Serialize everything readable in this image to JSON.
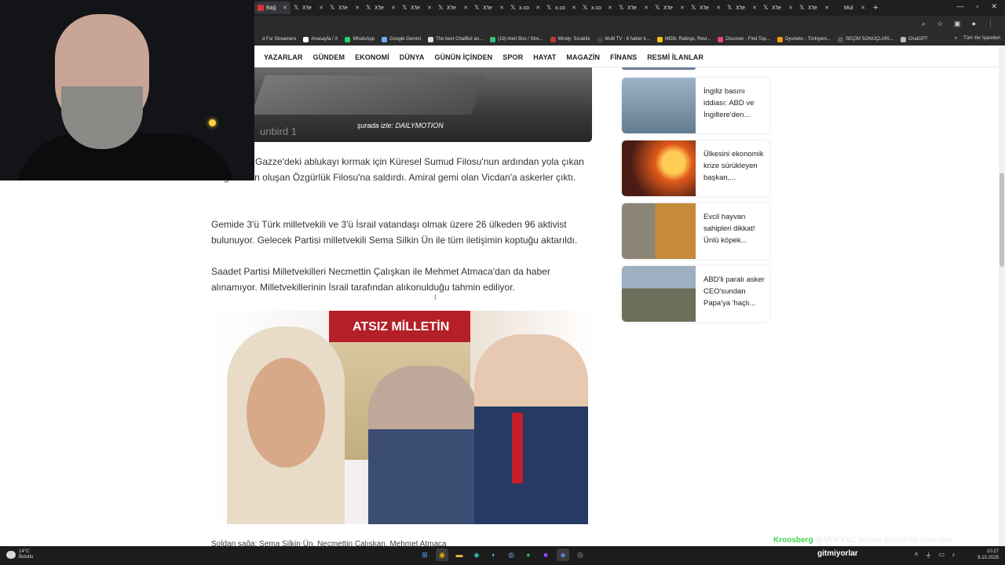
{
  "tabs": [
    {
      "label": "Bağ",
      "favicon": "red",
      "active": true
    },
    {
      "label": "X'te",
      "favicon": "x"
    },
    {
      "label": "X'te",
      "favicon": "x"
    },
    {
      "label": "X'te",
      "favicon": "x"
    },
    {
      "label": "X'te",
      "favicon": "x"
    },
    {
      "label": "X'te",
      "favicon": "x"
    },
    {
      "label": "X'te",
      "favicon": "x"
    },
    {
      "label": "x.co",
      "favicon": "x"
    },
    {
      "label": "x.co",
      "favicon": "x"
    },
    {
      "label": "x.co",
      "favicon": "x"
    },
    {
      "label": "X'te",
      "favicon": "x"
    },
    {
      "label": "X'te",
      "favicon": "x"
    },
    {
      "label": "X'te",
      "favicon": "x"
    },
    {
      "label": "X'te",
      "favicon": "x"
    },
    {
      "label": "X'te",
      "favicon": "x"
    },
    {
      "label": "X'te",
      "favicon": "x"
    },
    {
      "label": "Mul",
      "favicon": "m"
    }
  ],
  "bookmarks": [
    {
      "label": "d For Streamers",
      "color": "#2b2b2b"
    },
    {
      "label": "Anasayfa / X",
      "color": "#ffffff"
    },
    {
      "label": "WhatsApp",
      "color": "#25d366"
    },
    {
      "label": "Google Gemini",
      "color": "#7aa7ff"
    },
    {
      "label": "The best ChatBot an...",
      "color": "#dddddd"
    },
    {
      "label": "(19) Alert Box / Stre...",
      "color": "#31c27c"
    },
    {
      "label": "Windy: Sıcaklık",
      "color": "#c0392b"
    },
    {
      "label": "Multi TV - 6 haber k...",
      "color": "#444444"
    },
    {
      "label": "IMDb: Ratings, Revi...",
      "color": "#f5c518"
    },
    {
      "label": "Discover - Find Top...",
      "color": "#e84393"
    },
    {
      "label": "Oyuneks - Türkiyeni...",
      "color": "#f39c12"
    },
    {
      "label": "SEÇİM SONUÇLARI...",
      "color": "#555555"
    },
    {
      "label": "ChatGPT",
      "color": "#bbbbbb"
    }
  ],
  "bookmarks_other": "Tüm Yer İşaretleri",
  "nav": [
    "YAZARLAR",
    "GÜNDEM",
    "EKONOMİ",
    "DÜNYA",
    "GÜNÜN İÇİNDEN",
    "SPOR",
    "HAYAT",
    "MAGAZİN",
    "FİNANS",
    "RESMİ İLANLAR"
  ],
  "video": {
    "caption": "şurada izle: DAILYMOTION",
    "watermark": "unbird 1"
  },
  "article": {
    "p1": "...anması, Gazze'deki ablukayı kırmak için Küresel Sumud Filosu'nun ardından yola çıkan 11 gemiden oluşan Özgürlük Filosu'na saldırdı. Amiral gemi olan Vicdan'a askerler çıktı.",
    "p2": "Gemide 3'ü Türk milletvekili ve 3'ü İsrail vatandaşı olmak üzere 26 ülkeden 96 aktivist bulunuyor. Gelecek Partisi milletvekili Sema Silkin Ün ile tüm iletişimin koptuğu aktarıldı.",
    "p3": "Saadet Partisi Milletvekilleri Necmettin Çalışkan ile Mehmet Atmaca'dan da haber alınamıyor. Milletvekillerinin İsrail tarafından alıkonulduğu tahmin ediliyor.",
    "photo_banner": "ATSIZ MİLLETİN",
    "photo_caption": "Soldan sağa: Sema Silkin Ün, Necmettin Çalışkan, Mehmet Atmaca"
  },
  "sidebar": {
    "items": [
      {
        "title": "İngiliz basını iddiası: ABD ve İngiltere'den..."
      },
      {
        "title": "Ülkesini ekonomik krize sürükleyen başkan,..."
      },
      {
        "title": "Evcil hayvan sahipleri dikkat! Ünlü köpek..."
      },
      {
        "title": "ABD'li paralı asker CEO'sundan Papa'ya 'haçlı..."
      }
    ]
  },
  "overlay": {
    "user": "Kroosberg",
    "message": "@MUKYVZ hocam Atatürk'ün yolundan"
  },
  "taskbar": {
    "weather_temp": "14°C",
    "weather_desc": "Bulutlu",
    "label": "gitmiyorlar",
    "time": "10:27",
    "date": "8.10.2025"
  }
}
